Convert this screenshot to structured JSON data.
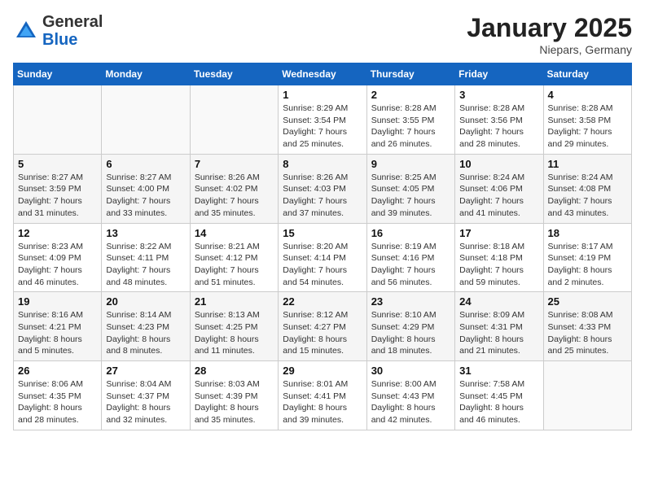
{
  "header": {
    "logo_general": "General",
    "logo_blue": "Blue",
    "month_title": "January 2025",
    "location": "Niepars, Germany"
  },
  "days_of_week": [
    "Sunday",
    "Monday",
    "Tuesday",
    "Wednesday",
    "Thursday",
    "Friday",
    "Saturday"
  ],
  "weeks": [
    [
      {
        "day": "",
        "info": ""
      },
      {
        "day": "",
        "info": ""
      },
      {
        "day": "",
        "info": ""
      },
      {
        "day": "1",
        "info": "Sunrise: 8:29 AM\nSunset: 3:54 PM\nDaylight: 7 hours\nand 25 minutes."
      },
      {
        "day": "2",
        "info": "Sunrise: 8:28 AM\nSunset: 3:55 PM\nDaylight: 7 hours\nand 26 minutes."
      },
      {
        "day": "3",
        "info": "Sunrise: 8:28 AM\nSunset: 3:56 PM\nDaylight: 7 hours\nand 28 minutes."
      },
      {
        "day": "4",
        "info": "Sunrise: 8:28 AM\nSunset: 3:58 PM\nDaylight: 7 hours\nand 29 minutes."
      }
    ],
    [
      {
        "day": "5",
        "info": "Sunrise: 8:27 AM\nSunset: 3:59 PM\nDaylight: 7 hours\nand 31 minutes."
      },
      {
        "day": "6",
        "info": "Sunrise: 8:27 AM\nSunset: 4:00 PM\nDaylight: 7 hours\nand 33 minutes."
      },
      {
        "day": "7",
        "info": "Sunrise: 8:26 AM\nSunset: 4:02 PM\nDaylight: 7 hours\nand 35 minutes."
      },
      {
        "day": "8",
        "info": "Sunrise: 8:26 AM\nSunset: 4:03 PM\nDaylight: 7 hours\nand 37 minutes."
      },
      {
        "day": "9",
        "info": "Sunrise: 8:25 AM\nSunset: 4:05 PM\nDaylight: 7 hours\nand 39 minutes."
      },
      {
        "day": "10",
        "info": "Sunrise: 8:24 AM\nSunset: 4:06 PM\nDaylight: 7 hours\nand 41 minutes."
      },
      {
        "day": "11",
        "info": "Sunrise: 8:24 AM\nSunset: 4:08 PM\nDaylight: 7 hours\nand 43 minutes."
      }
    ],
    [
      {
        "day": "12",
        "info": "Sunrise: 8:23 AM\nSunset: 4:09 PM\nDaylight: 7 hours\nand 46 minutes."
      },
      {
        "day": "13",
        "info": "Sunrise: 8:22 AM\nSunset: 4:11 PM\nDaylight: 7 hours\nand 48 minutes."
      },
      {
        "day": "14",
        "info": "Sunrise: 8:21 AM\nSunset: 4:12 PM\nDaylight: 7 hours\nand 51 minutes."
      },
      {
        "day": "15",
        "info": "Sunrise: 8:20 AM\nSunset: 4:14 PM\nDaylight: 7 hours\nand 54 minutes."
      },
      {
        "day": "16",
        "info": "Sunrise: 8:19 AM\nSunset: 4:16 PM\nDaylight: 7 hours\nand 56 minutes."
      },
      {
        "day": "17",
        "info": "Sunrise: 8:18 AM\nSunset: 4:18 PM\nDaylight: 7 hours\nand 59 minutes."
      },
      {
        "day": "18",
        "info": "Sunrise: 8:17 AM\nSunset: 4:19 PM\nDaylight: 8 hours\nand 2 minutes."
      }
    ],
    [
      {
        "day": "19",
        "info": "Sunrise: 8:16 AM\nSunset: 4:21 PM\nDaylight: 8 hours\nand 5 minutes."
      },
      {
        "day": "20",
        "info": "Sunrise: 8:14 AM\nSunset: 4:23 PM\nDaylight: 8 hours\nand 8 minutes."
      },
      {
        "day": "21",
        "info": "Sunrise: 8:13 AM\nSunset: 4:25 PM\nDaylight: 8 hours\nand 11 minutes."
      },
      {
        "day": "22",
        "info": "Sunrise: 8:12 AM\nSunset: 4:27 PM\nDaylight: 8 hours\nand 15 minutes."
      },
      {
        "day": "23",
        "info": "Sunrise: 8:10 AM\nSunset: 4:29 PM\nDaylight: 8 hours\nand 18 minutes."
      },
      {
        "day": "24",
        "info": "Sunrise: 8:09 AM\nSunset: 4:31 PM\nDaylight: 8 hours\nand 21 minutes."
      },
      {
        "day": "25",
        "info": "Sunrise: 8:08 AM\nSunset: 4:33 PM\nDaylight: 8 hours\nand 25 minutes."
      }
    ],
    [
      {
        "day": "26",
        "info": "Sunrise: 8:06 AM\nSunset: 4:35 PM\nDaylight: 8 hours\nand 28 minutes."
      },
      {
        "day": "27",
        "info": "Sunrise: 8:04 AM\nSunset: 4:37 PM\nDaylight: 8 hours\nand 32 minutes."
      },
      {
        "day": "28",
        "info": "Sunrise: 8:03 AM\nSunset: 4:39 PM\nDaylight: 8 hours\nand 35 minutes."
      },
      {
        "day": "29",
        "info": "Sunrise: 8:01 AM\nSunset: 4:41 PM\nDaylight: 8 hours\nand 39 minutes."
      },
      {
        "day": "30",
        "info": "Sunrise: 8:00 AM\nSunset: 4:43 PM\nDaylight: 8 hours\nand 42 minutes."
      },
      {
        "day": "31",
        "info": "Sunrise: 7:58 AM\nSunset: 4:45 PM\nDaylight: 8 hours\nand 46 minutes."
      },
      {
        "day": "",
        "info": ""
      }
    ]
  ]
}
